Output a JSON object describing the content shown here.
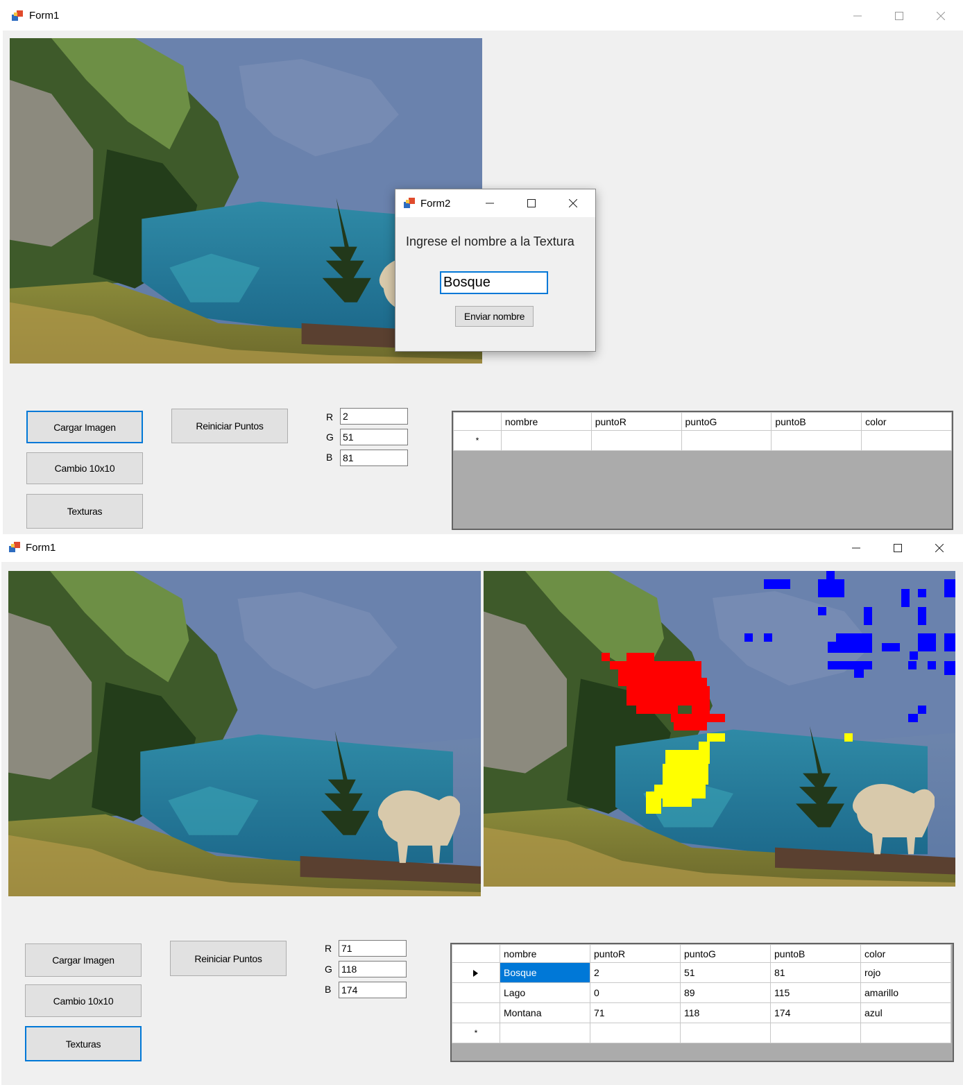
{
  "window_top": {
    "title": "Form1",
    "buttons": {
      "load": "Cargar Imagen",
      "change": "Cambio 10x10",
      "textures": "Texturas",
      "reset": "Reiniciar Puntos"
    },
    "rgb": {
      "r_label": "R",
      "g_label": "G",
      "b_label": "B",
      "r": "2",
      "g": "51",
      "b": "81"
    },
    "grid": {
      "columns": [
        "nombre",
        "puntoR",
        "puntoG",
        "puntoB",
        "color"
      ],
      "new_row_marker": "*"
    }
  },
  "dialog": {
    "title": "Form2",
    "prompt": "Ingrese el nombre a la Textura",
    "name_value": "Bosque",
    "submit": "Enviar nombre"
  },
  "window_bottom": {
    "title": "Form1",
    "buttons": {
      "load": "Cargar Imagen",
      "change": "Cambio 10x10",
      "textures": "Texturas",
      "reset": "Reiniciar Puntos"
    },
    "rgb": {
      "r_label": "R",
      "g_label": "G",
      "b_label": "B",
      "r": "71",
      "g": "118",
      "b": "174"
    },
    "grid": {
      "columns": [
        "nombre",
        "puntoR",
        "puntoG",
        "puntoB",
        "color"
      ],
      "rows": [
        [
          "Bosque",
          "2",
          "51",
          "81",
          "rojo"
        ],
        [
          "Lago",
          "0",
          "89",
          "115",
          "amarillo"
        ],
        [
          "Montana",
          "71",
          "118",
          "174",
          "azul"
        ]
      ],
      "new_row_marker": "*"
    },
    "overlay_colors": {
      "rojo": "#ff0000",
      "amarillo": "#ffff00",
      "azul": "#0000ff"
    }
  }
}
